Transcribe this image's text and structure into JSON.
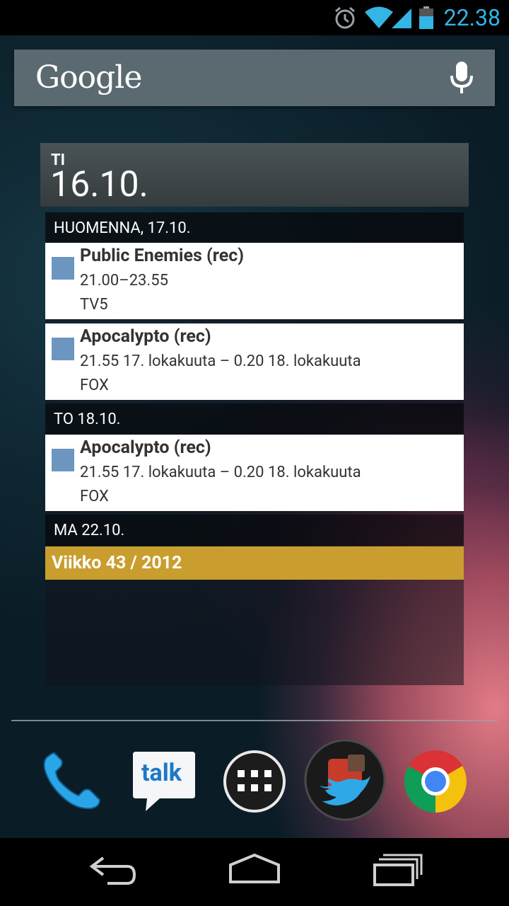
{
  "status_bar": {
    "time": "22.38",
    "icons": [
      "alarm-icon",
      "wifi-icon",
      "signal-icon",
      "battery-icon"
    ],
    "accent_color": "#33b5e5"
  },
  "search_bar": {
    "logo_text": "Google",
    "voice_icon": "mic-icon"
  },
  "widget": {
    "header": {
      "day": "TI",
      "date": "16.10."
    },
    "days": [
      {
        "label": "HUOMENNA, 17.10.",
        "events": [
          {
            "title": "Public Enemies (rec)",
            "time": "21.00–23.55",
            "channel": "TV5"
          },
          {
            "title": "Apocalypto (rec)",
            "time": "21.55 17. lokakuuta – 0.20 18. lokakuuta",
            "channel": "FOX"
          }
        ]
      },
      {
        "label": "TO 18.10.",
        "events": [
          {
            "title": "Apocalypto (rec)",
            "time": "21.55 17. lokakuuta – 0.20 18. lokakuuta",
            "channel": "FOX"
          }
        ]
      },
      {
        "label": "MA 22.10.",
        "events": []
      }
    ],
    "week_label": "Viikko 43 / 2012",
    "event_color": "#6c95c0",
    "week_color": "#c99e2e"
  },
  "dock": {
    "apps": [
      {
        "name": "Phone",
        "icon": "phone-icon"
      },
      {
        "name": "Talk",
        "icon": "talk-icon",
        "label": "talk"
      },
      {
        "name": "All apps",
        "icon": "apps-grid-icon"
      },
      {
        "name": "Folder",
        "icon": "folder-icon"
      },
      {
        "name": "Chrome",
        "icon": "chrome-icon"
      }
    ]
  },
  "nav_bar": {
    "buttons": [
      "back-icon",
      "home-icon",
      "recents-icon"
    ]
  }
}
